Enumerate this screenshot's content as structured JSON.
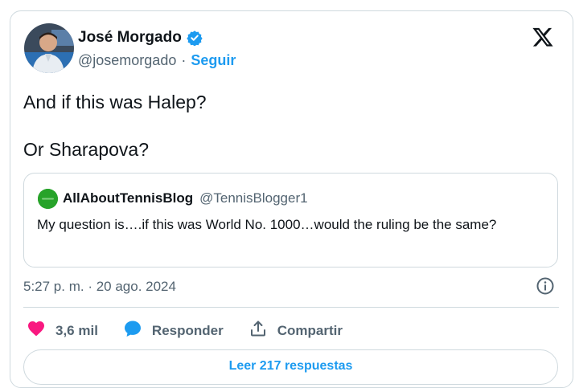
{
  "tweet": {
    "author": {
      "name": "José Morgado",
      "handle": "@josemorgado",
      "separator": "·",
      "follow_label": "Seguir",
      "verified": true
    },
    "text_lines": [
      "And if this was Halep?",
      "Or Sharapova?"
    ],
    "quoted": {
      "name": "AllAboutTennisBlog",
      "handle": "@TennisBlogger1",
      "text": "My question is….if this was World No. 1000…would the ruling be the same?"
    },
    "timestamp": "5:27 p. m. · 20 ago. 2024",
    "actions": {
      "likes": "3,6 mil",
      "reply_label": "Responder",
      "share_label": "Compartir"
    },
    "read_replies_label": "Leer 217 respuestas"
  },
  "colors": {
    "accent": "#1d9bf0",
    "like": "#f91880",
    "text": "#0f1419",
    "secondary": "#536471",
    "border": "#cfd9de",
    "quote_avatar": "#27a32a"
  },
  "icons": {
    "verified": "verified-badge-icon",
    "platform": "x-logo-icon",
    "info": "info-icon",
    "like": "heart-icon",
    "reply": "speech-bubble-icon",
    "share": "share-upload-icon"
  }
}
